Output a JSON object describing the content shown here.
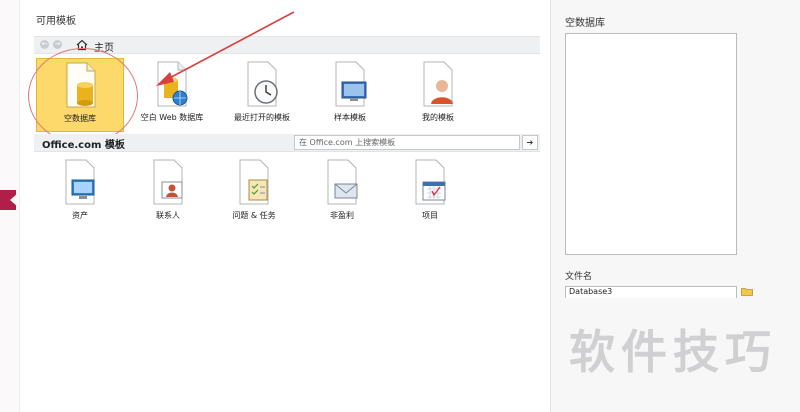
{
  "available_templates": {
    "title": "可用模板",
    "nav": {
      "back": "←",
      "forward": "→",
      "home_label": "主页"
    },
    "tiles": [
      {
        "label": "空数据库",
        "icon": "database-document-icon",
        "selected": true
      },
      {
        "label": "空白 Web 数据库",
        "icon": "web-database-icon"
      },
      {
        "label": "最近打开的模板",
        "icon": "recent-clock-icon"
      },
      {
        "label": "样本模板",
        "icon": "sample-screen-icon"
      },
      {
        "label": "我的模板",
        "icon": "user-person-icon"
      }
    ]
  },
  "office_templates": {
    "title": "Office.com 模板",
    "search_placeholder": "在 Office.com 上搜索模板",
    "search_button": "➔",
    "tiles": [
      {
        "label": "资产",
        "icon": "asset-monitor-icon"
      },
      {
        "label": "联系人",
        "icon": "contact-card-icon"
      },
      {
        "label": "问题 & 任务",
        "icon": "task-checklist-icon"
      },
      {
        "label": "非盈利",
        "icon": "nonprofit-envelope-icon"
      },
      {
        "label": "项目",
        "icon": "project-calendar-icon"
      }
    ]
  },
  "side_panel": {
    "title": "空数据库",
    "filename_label": "文件名",
    "filename_value": "Database3"
  },
  "watermark": "软件技巧",
  "colors": {
    "selected_tile": "#fcd96a",
    "annotation_red": "#d94040",
    "db_gold": "#e8b31c"
  }
}
